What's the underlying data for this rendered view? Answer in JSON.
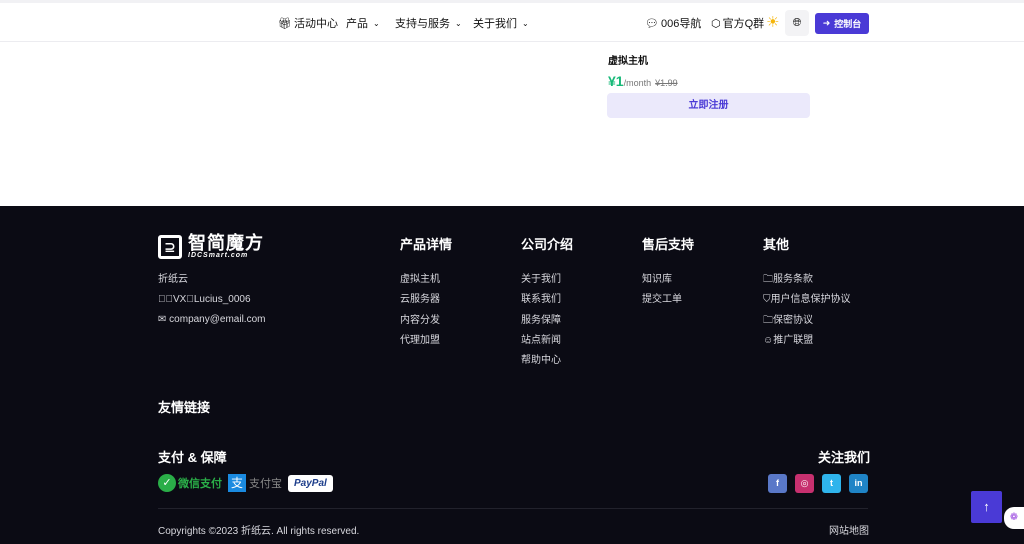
{
  "nav": {
    "activity": "活动中心",
    "products": "产品",
    "support": "支持与服务",
    "about": "关于我们",
    "nav006": "006导航",
    "qq": "官方Q群",
    "console": "控制台"
  },
  "product": {
    "title": "虚拟主机",
    "price": "¥1",
    "unit": "/month",
    "old_price": "¥1.99",
    "register": "立即注册"
  },
  "footer": {
    "logo_cn": "智简魔方",
    "logo_en": "IDCSmart.com",
    "company": "折纸云",
    "vx": "VX：Lucius_0006",
    "email": "company@email.com",
    "columns": [
      {
        "title": "产品详情",
        "items": [
          "虚拟主机",
          "云服务器",
          "内容分发",
          "代理加盟"
        ]
      },
      {
        "title": "公司介绍",
        "items": [
          "关于我们",
          "联系我们",
          "服务保障",
          "站点新闻",
          "帮助中心"
        ]
      },
      {
        "title": "售后支持",
        "items": [
          "知识库",
          "提交工单"
        ]
      },
      {
        "title": "其他",
        "items": [
          "服务条款",
          "用户信息保护协议",
          "保密协议",
          "推广联盟"
        ]
      }
    ],
    "links_title": "友情链接",
    "pay_title": "支付 & 保障",
    "pay": {
      "wechat": "微信支付",
      "alipay": "支付宝",
      "paypal": "PayPal"
    },
    "follow_title": "关注我们",
    "social": {
      "facebook": "f",
      "instagram": "◎",
      "twitter": "t",
      "linkedin": "in"
    },
    "copyright": "Copyrights ©2023 折纸云. All rights reserved.",
    "sitemap": "网站地图"
  },
  "colors": {
    "accent": "#4a3ad6",
    "footer_bg": "#0b0b14",
    "price": "#17b978"
  }
}
